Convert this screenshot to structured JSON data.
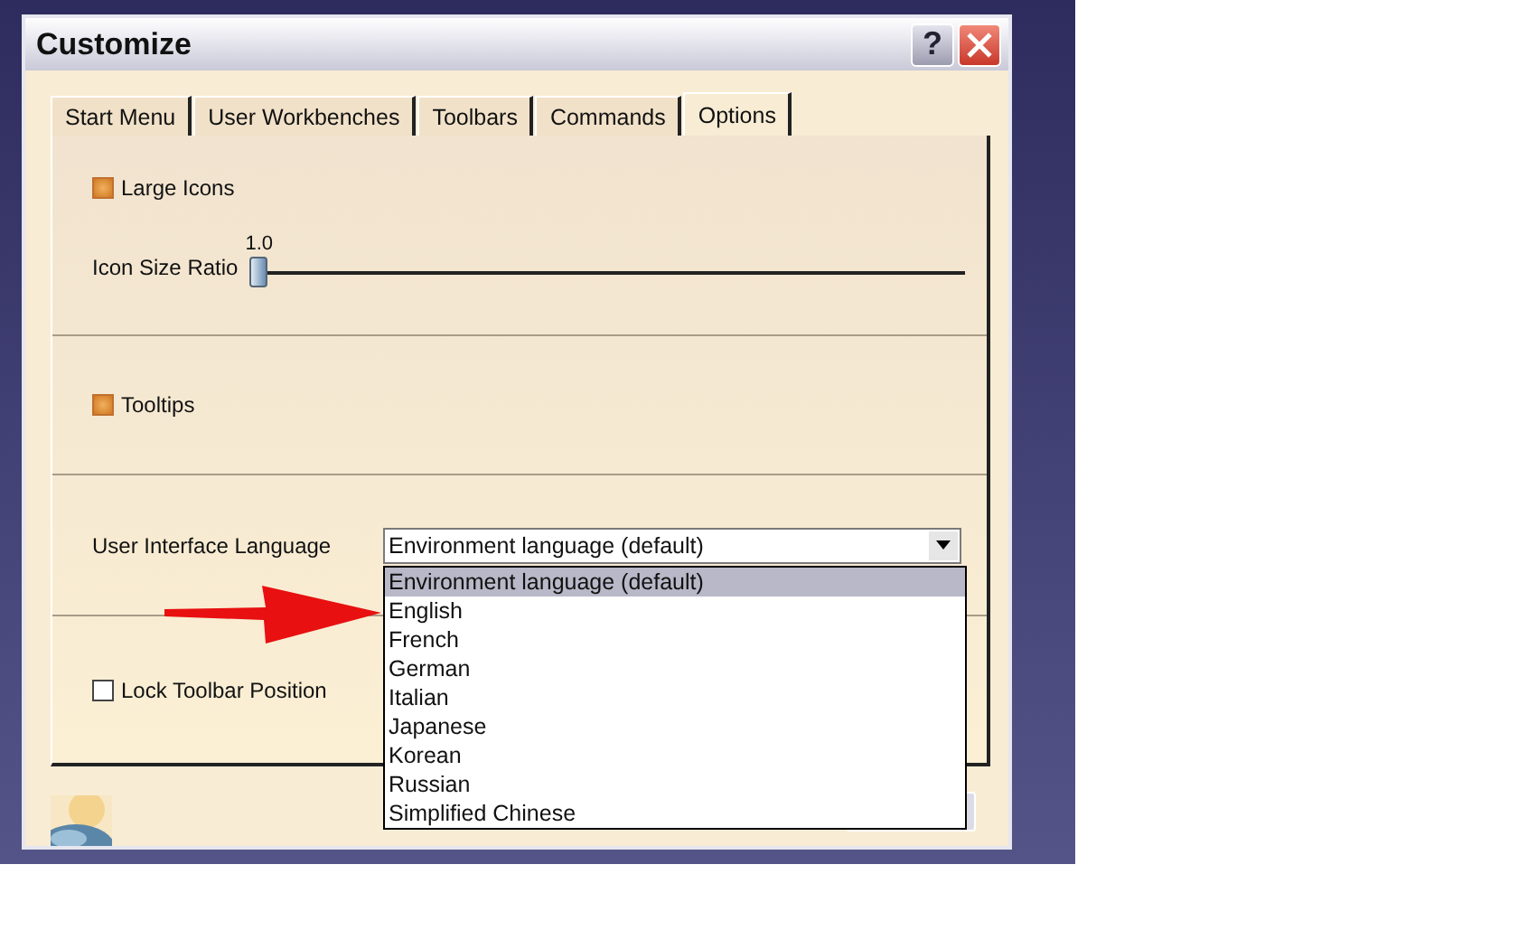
{
  "window": {
    "title": "Customize"
  },
  "title_buttons": [
    {
      "kind": "help",
      "label": "?"
    },
    {
      "kind": "close"
    }
  ],
  "tabs": [
    {
      "label": "Start Menu",
      "selected": false
    },
    {
      "label": "User Workbenches",
      "selected": false
    },
    {
      "label": "Toolbars",
      "selected": false
    },
    {
      "label": "Commands",
      "selected": false
    },
    {
      "label": "Options",
      "selected": true
    }
  ],
  "options": {
    "large_icons": {
      "label": "Large Icons",
      "checked": true
    },
    "icon_size_ratio": {
      "label": "Icon Size Ratio",
      "reading": "1.0",
      "level": 0.0
    },
    "tooltips": {
      "label": "Tooltips",
      "checked": true
    },
    "language": {
      "label": "User Interface Language",
      "value": "Environment language (default)",
      "expanded": true,
      "items": [
        {
          "label": "Environment language (default)",
          "selected": true
        },
        {
          "label": "English",
          "selected": false
        },
        {
          "label": "French",
          "selected": false
        },
        {
          "label": "German",
          "selected": false
        },
        {
          "label": "Italian",
          "selected": false
        },
        {
          "label": "Japanese",
          "selected": false
        },
        {
          "label": "Korean",
          "selected": false
        },
        {
          "label": "Russian",
          "selected": false
        },
        {
          "label": "Simplified Chinese",
          "selected": false
        }
      ]
    },
    "lock_toolbar": {
      "label": "Lock Toolbar Position",
      "checked": false
    }
  },
  "annotation": {
    "kind": "arrow",
    "color": "#e81010"
  }
}
